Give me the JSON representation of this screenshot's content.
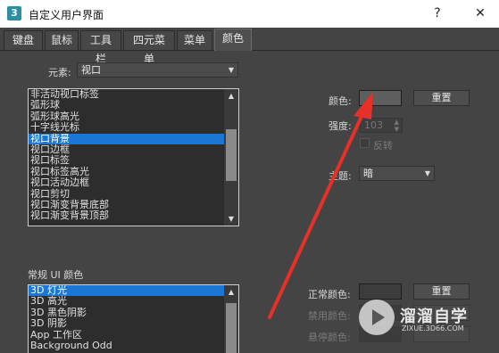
{
  "window": {
    "app_icon": "3",
    "title": "自定义用户界面",
    "help_glyph": "?",
    "close_glyph": "✕"
  },
  "tabs": [
    {
      "label": "键盘"
    },
    {
      "label": "鼠标"
    },
    {
      "label": "工具栏"
    },
    {
      "label": "四元菜单"
    },
    {
      "label": "菜单"
    },
    {
      "label": "颜色",
      "active": true
    }
  ],
  "elements": {
    "label": "元素:",
    "selected": "视口"
  },
  "element_list": {
    "items": [
      "非活动视口标签",
      "弧形球",
      "弧形球高光",
      "十字线光标",
      "视口背景",
      "视口边框",
      "视口标签",
      "视口标签高光",
      "视口活动边框",
      "视口剪切",
      "视口渐变背景底部",
      "视口渐变背景顶部"
    ],
    "selected_index": 4
  },
  "color_panel": {
    "color_label": "颜色:",
    "color_value": "#5e5e5e",
    "reset_label": "重置",
    "intensity_label": "强度:",
    "intensity_value": "103",
    "invert_label": "反转",
    "theme_label": "主题:",
    "theme_value": "暗"
  },
  "ui_colors": {
    "section_label": "常规 UI 颜色",
    "items": [
      "3D 灯光",
      "3D 高光",
      "3D 黑色阴影",
      "3D 阴影",
      "App 工作区",
      "Background Odd"
    ],
    "selected_index": 0,
    "normal_color_label": "正常颜色:",
    "normal_color_value": "#3c3c3c",
    "normal_reset_label": "重置",
    "disabled_color_label": "禁用颜色:",
    "hover_color_label": "悬停颜色:"
  },
  "watermark": {
    "title": "溜溜自学",
    "url": "ZIXUE.3D66.COM"
  },
  "colors": {
    "accent": "#1a78d4",
    "annotation_arrow": "#e8302a"
  }
}
